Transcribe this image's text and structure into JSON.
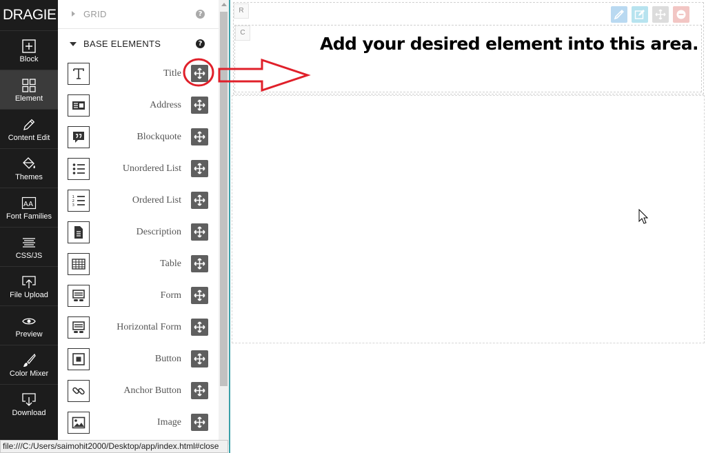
{
  "app": {
    "brand": "DRAGIE"
  },
  "nav": {
    "items": [
      {
        "label": "Block",
        "icon": "plus-square-icon"
      },
      {
        "label": "Element",
        "icon": "grid-icon",
        "active": true
      },
      {
        "label": "Content Edit",
        "icon": "pencil-icon"
      },
      {
        "label": "Themes",
        "icon": "paint-bucket-icon"
      },
      {
        "label": "Font Families",
        "icon": "font-aa-icon"
      },
      {
        "label": "CSS/JS",
        "icon": "lines-icon"
      },
      {
        "label": "File Upload",
        "icon": "upload-icon"
      },
      {
        "label": "Preview",
        "icon": "eye-icon"
      },
      {
        "label": "Color Mixer",
        "icon": "brush-icon"
      },
      {
        "label": "Download",
        "icon": "download-icon"
      }
    ]
  },
  "panel": {
    "grid_section": {
      "title": "GRID",
      "expanded": false,
      "help": "?"
    },
    "base_section": {
      "title": "BASE ELEMENTS",
      "expanded": true,
      "help": "?"
    },
    "elements": [
      {
        "label": "Title",
        "icon": "title-t-icon"
      },
      {
        "label": "Address",
        "icon": "address-card-icon"
      },
      {
        "label": "Blockquote",
        "icon": "quote-bubble-icon"
      },
      {
        "label": "Unordered List",
        "icon": "bullet-list-icon"
      },
      {
        "label": "Ordered List",
        "icon": "numbered-list-icon"
      },
      {
        "label": "Description",
        "icon": "document-icon"
      },
      {
        "label": "Table",
        "icon": "table-grid-icon"
      },
      {
        "label": "Form",
        "icon": "form-icon"
      },
      {
        "label": "Horizontal Form",
        "icon": "horizontal-form-icon"
      },
      {
        "label": "Button",
        "icon": "button-icon"
      },
      {
        "label": "Anchor Button",
        "icon": "link-chain-icon"
      },
      {
        "label": "Image",
        "icon": "image-icon"
      }
    ]
  },
  "canvas": {
    "row_tag": "R",
    "col_tag": "C",
    "drop_hint": "Add your desired element into this area.",
    "tools": [
      {
        "icon": "eyedropper-icon",
        "color": "#b9d9f1"
      },
      {
        "icon": "edit-icon",
        "color": "#b7e3ef"
      },
      {
        "icon": "move-icon",
        "color": "#dcdcdc"
      },
      {
        "icon": "remove-icon",
        "color": "#f2c6c4"
      }
    ]
  },
  "status_bar": {
    "url": "file:///C:/Users/saimohit2000/Desktop/app/index.html#close"
  },
  "colors": {
    "nav_bg": "#1c1c1c",
    "nav_active": "#3b3b3b",
    "drag_button": "#5f5f5f",
    "annotation_red": "#e0202a",
    "panel_divider": "#3aa0a8"
  }
}
